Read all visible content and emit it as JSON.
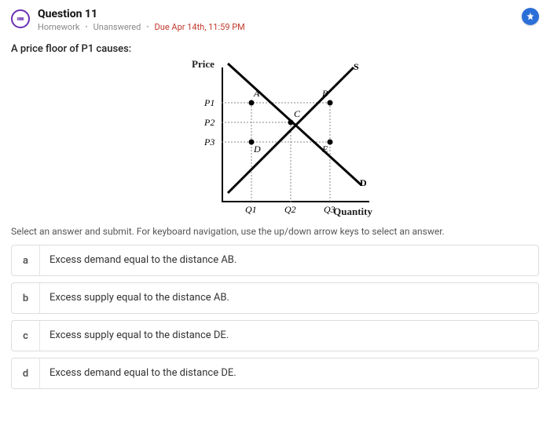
{
  "header": {
    "question_label": "Question 11",
    "tag1": "Homework",
    "tag2": "Unanswered",
    "due": "Due Apr 14th, 11:59 PM"
  },
  "prompt": "A price floor of P1 causes:",
  "instructions": "Select an answer and submit. For keyboard navigation, use the up/down arrow keys to select an answer.",
  "options": [
    {
      "key": "a",
      "text": "Excess demand equal to the distance AB."
    },
    {
      "key": "b",
      "text": "Excess supply equal to the distance AB."
    },
    {
      "key": "c",
      "text": "Excess supply equal to the distance DE."
    },
    {
      "key": "d",
      "text": "Excess demand equal to the distance DE."
    }
  ],
  "chart_data": {
    "type": "diagram",
    "title": "",
    "xlabel": "Quantity",
    "ylabel": "Price",
    "y_ticks": [
      "P1",
      "P2",
      "P3"
    ],
    "x_ticks": [
      "Q1",
      "Q2",
      "Q3"
    ],
    "curves": [
      "S",
      "D"
    ],
    "points": [
      "A",
      "B",
      "C",
      "D",
      "E"
    ],
    "description": "Supply (S) upward-sloping and Demand (D) downward-sloping cross at C (P2, Q2). At P1 above equilibrium: A on demand (Q1) and B on supply (Q3). At P3 below equilibrium: D on supply (Q1) and E on demand (Q3)."
  }
}
